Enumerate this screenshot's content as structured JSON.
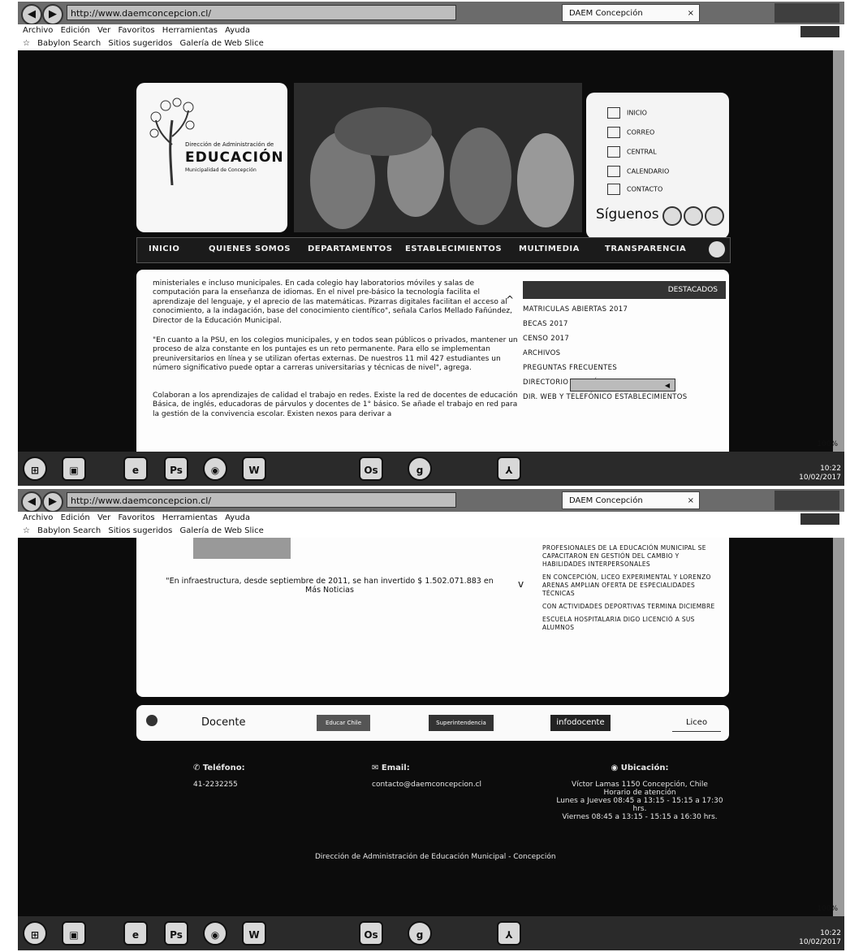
{
  "browser": {
    "url1": "http://www.daemconcepcion.cl/",
    "url2": "http://www.daemconcepcion.cl/",
    "tab_title": "DAEM Concepción",
    "tab_close": "×",
    "menu": [
      "Archivo",
      "Edición",
      "Ver",
      "Favoritos",
      "Herramientas",
      "Ayuda"
    ],
    "favorites": [
      "Babylon Search",
      "Sitios sugeridos",
      "Galería de Web Slice"
    ],
    "zoom": "100%",
    "clock_time": "10:22",
    "clock_date": "10/02/2017"
  },
  "header": {
    "logo_line1": "Dirección de Administración de",
    "logo_line2": "EDUCACIÓN",
    "logo_line3": "Municipalidad de Concepción",
    "quick_links": [
      "INICIO",
      "CORREO",
      "CENTRAL",
      "CALENDARIO",
      "CONTACTO"
    ],
    "follow": "Síguenos"
  },
  "nav": {
    "items": [
      "INICIO",
      "QUIENES SOMOS",
      "DEPARTAMENTOS",
      "ESTABLECIMIENTOS",
      "MULTIMEDIA",
      "TRANSPARENCIA"
    ]
  },
  "article": {
    "p1": "ministeriales e incluso municipales. En cada colegio hay laboratorios móviles y salas de computación para la enseñanza de idiomas. En el nivel pre-básico la tecnología facilita el aprendizaje del lenguaje, y el aprecio de las matemáticas. Pizarras digitales facilitan el acceso al conocimiento, a la indagación, base del conocimiento científico\", señala Carlos Mellado Fañúndez, Director de la Educación Municipal.",
    "p2": "\"En cuanto a la PSU, en los colegios municipales, y en todos sean públicos o privados, mantener un proceso de alza constante en los puntajes es un reto permanente. Para ello se implementan preuniversitarios en línea y se utilizan ofertas externas. De nuestros 11 mil 427 estudiantes un número significativo puede optar a carreras universitarias y técnicas de nivel\", agrega.",
    "p3": "Colaboran a los aprendizajes de calidad el trabajo en redes. Existe la red de docentes de educación Básica, de inglés, educadoras de párvulos y docentes de 1° básico. Se añade el trabajo en red para la gestión de la convivencia escolar. Existen nexos para derivar a",
    "infra": "\"En infraestructura, desde septiembre de 2011, se han invertido $ 1.502.071.883 en",
    "infra2": "Más Noticias"
  },
  "sidebar": {
    "heading": "DESTACADOS",
    "links": [
      "MATRICULAS ABIERTAS 2017",
      "BECAS 2017",
      "CENSO 2017",
      "ARCHIVOS",
      "PREGUNTAS FRECUENTES",
      "DIRECTORIO TELEFÓNICO DAEM",
      "DIR. WEB Y TELEFÓNICO ESTABLECIMIENTOS"
    ],
    "news": [
      "PROFESIONALES DE LA EDUCACIÓN MUNICIPAL SE CAPACITARON EN GESTIÓN DEL CAMBIO Y HABILIDADES INTERPERSONALES",
      "EN CONCEPCIÓN, LICEO EXPERIMENTAL Y LORENZO ARENAS AMPLIAN OFERTA DE ESPECIALIDADES TÉCNICAS",
      "CON ACTIVIDADES DEPORTIVAS TERMINA DICIEMBRE",
      "ESCUELA HOSPITALARIA DIGO LICENCIÓ A SUS ALUMNOS"
    ]
  },
  "partners": [
    "Docente",
    "Educar Chile",
    "Superintendencia",
    "infodocente",
    "Liceo"
  ],
  "footer": {
    "phone_label": "Teléfono:",
    "phone": "41-2232255",
    "email_label": "Email:",
    "email": "contacto@daemconcepcion.cl",
    "location_label": "Ubicación:",
    "address": "Víctor Lamas 1150 Concepción, Chile",
    "hours_label": "Horario de atención",
    "hours1": "Lunes a Jueves 08:45 a 13:15 - 15:15 a 17:30 hrs.",
    "hours2": "Viernes 08:45 a 13:15 - 15:15 a 16:30 hrs.",
    "copyright": "Dirección de Administración de Educación Municipal - Concepción"
  },
  "taskbar": [
    "e",
    "Ps",
    "W",
    "Os",
    "g"
  ]
}
